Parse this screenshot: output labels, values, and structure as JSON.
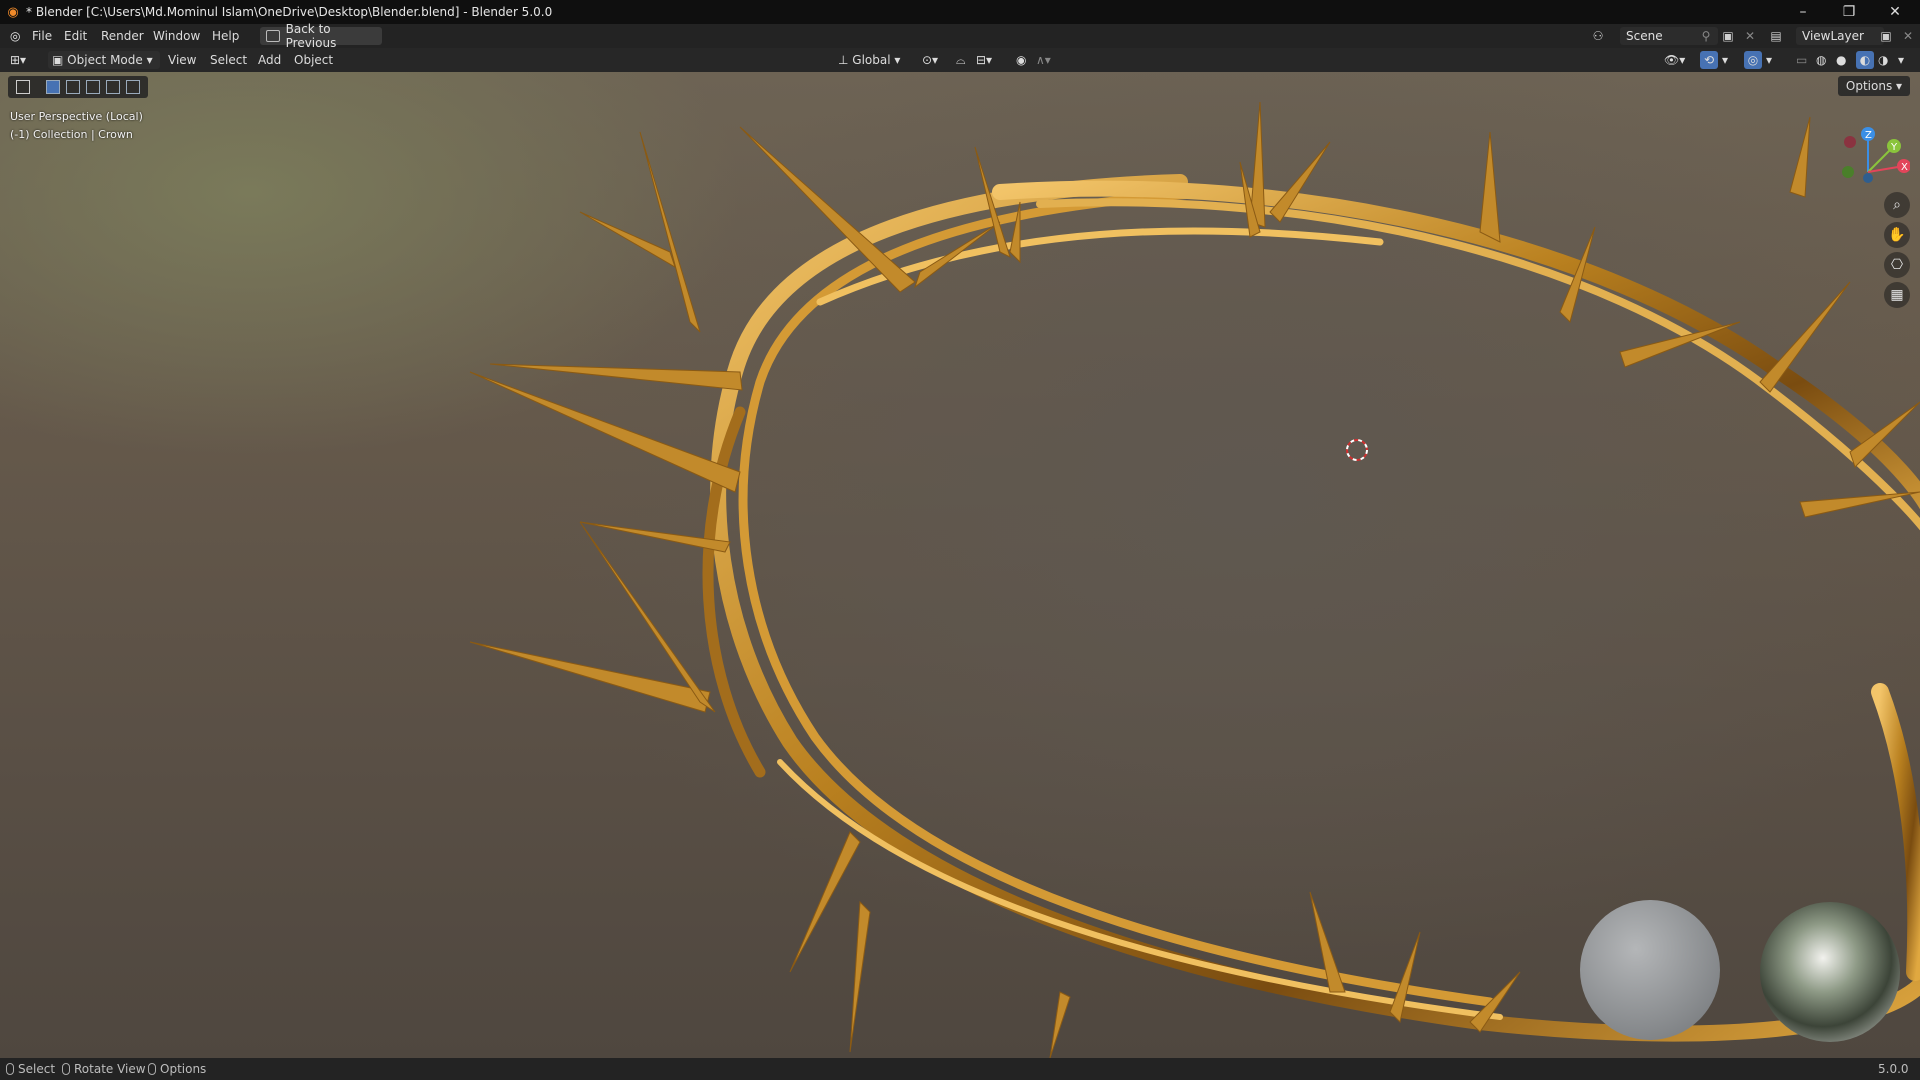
{
  "window": {
    "title": "* Blender [C:\\Users\\Md.Mominul Islam\\OneDrive\\Desktop\\Blender.blend] - Blender 5.0.0",
    "controls": {
      "minimize": "–",
      "restore": "❐",
      "close": "✕"
    }
  },
  "topbar": {
    "menus": [
      "File",
      "Edit",
      "Render",
      "Window",
      "Help"
    ],
    "back_button": "Back to Previous",
    "scene_label": "Scene",
    "view_layer_label": "ViewLayer"
  },
  "viewport_header": {
    "mode": "Object Mode",
    "menus": [
      "View",
      "Select",
      "Add",
      "Object"
    ],
    "transform_orientation": "Global",
    "options": "Options"
  },
  "viewport": {
    "perspective": "User Perspective (Local)",
    "collection": "(-1) Collection | Crown",
    "gizmo_axes": {
      "z": "Z",
      "y": "Y",
      "x": "X"
    },
    "accent_colors": {
      "x_axis": "#e2455a",
      "y_axis": "#8ac43c",
      "z_axis": "#3b8fe6",
      "gold": "#c58e2a"
    }
  },
  "statusbar": {
    "hints": [
      "Select",
      "Rotate View",
      "Options"
    ],
    "version": "5.0.0"
  }
}
